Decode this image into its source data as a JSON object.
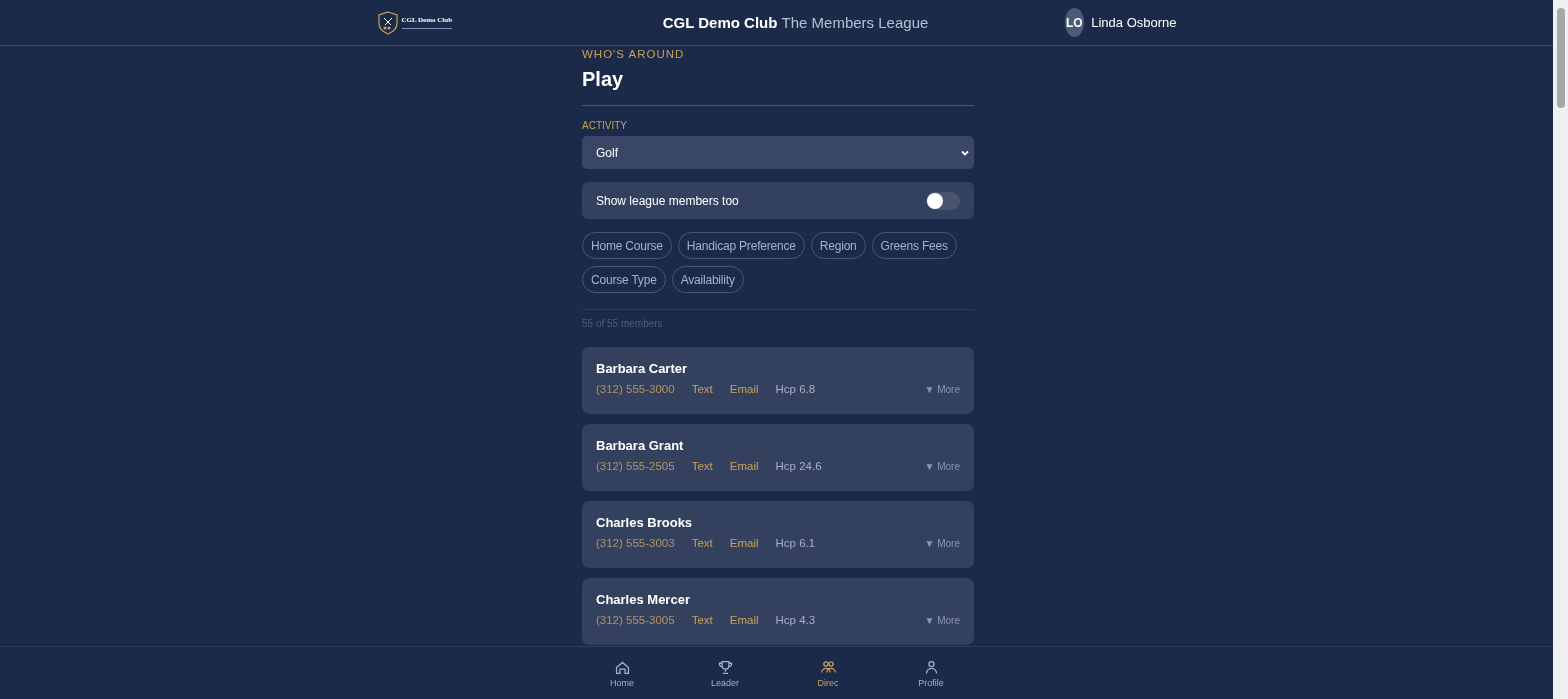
{
  "header": {
    "logo_text": "CGL Demo Club",
    "club": "CGL Demo Club",
    "league": "The Members League",
    "user": {
      "initials": "LO",
      "name": "Linda Osborne"
    }
  },
  "page": {
    "eyebrow": "WHO'S AROUND",
    "title": "Play"
  },
  "activity": {
    "label": "ACTIVITY",
    "value": "Golf"
  },
  "league_toggle": {
    "label": "Show league members too",
    "on": false
  },
  "filters": [
    {
      "label": "Home Course",
      "selected": false
    },
    {
      "label": "Handicap Preference",
      "selected": false
    },
    {
      "label": "Region",
      "selected": false
    },
    {
      "label": "Greens Fees",
      "selected": false
    },
    {
      "label": "Course Type",
      "selected": false
    },
    {
      "label": "Availability",
      "selected": false
    }
  ],
  "count": "55 of 55 members",
  "members": [
    {
      "name": "Barbara Carter",
      "phone": "(312) 555-3000",
      "text": "Text",
      "email": "Email",
      "hcp": "Hcp 6.8",
      "more": "▼ More"
    },
    {
      "name": "Barbara Grant",
      "phone": "(312) 555-2505",
      "text": "Text",
      "email": "Email",
      "hcp": "Hcp 24.6",
      "more": "▼ More"
    },
    {
      "name": "Charles Brooks",
      "phone": "(312) 555-3003",
      "text": "Text",
      "email": "Email",
      "hcp": "Hcp 6.1",
      "more": "▼ More"
    },
    {
      "name": "Charles Mercer",
      "phone": "(312) 555-3005",
      "text": "Text",
      "email": "Email",
      "hcp": "Hcp 4.3",
      "more": "▼ More"
    }
  ],
  "nav": [
    {
      "kind": "home",
      "label": "Home",
      "selected": false
    },
    {
      "kind": "trophy",
      "label": "Leader",
      "selected": false
    },
    {
      "kind": "people",
      "label": "Direc",
      "selected": true
    },
    {
      "kind": "person",
      "label": "Profile",
      "selected": false
    }
  ]
}
